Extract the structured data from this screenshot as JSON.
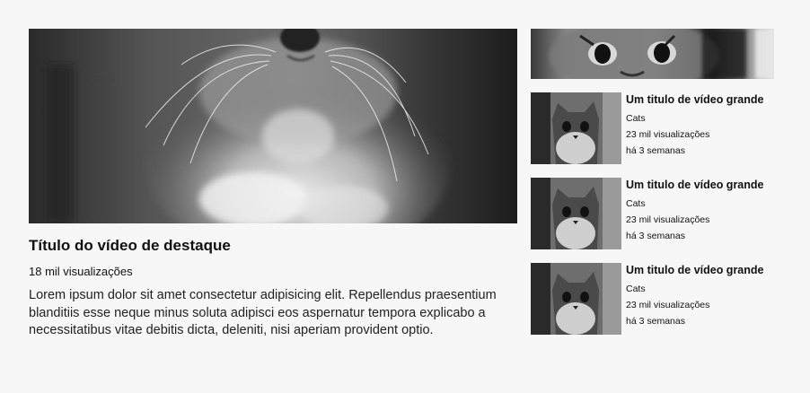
{
  "featured": {
    "thumbnail": "kitten-closeup-image",
    "title": "Título do vídeo de destaque",
    "views": "18 mil visualizações",
    "description": "Lorem ipsum dolor sit amet consectetur adipisicing elit. Repellendus praesentium blanditiis esse neque minus soluta adipisci eos aspernatur tempora explicabo a necessitatibus vitae debitis dicta, deleniti, nisi aperiam provident optio."
  },
  "sidebar": {
    "top_thumbnail": "kitten-eyes-banner-image",
    "videos": [
      {
        "thumbnail": "kitten-thumbnail-image",
        "title": "Um titulo de vídeo grande",
        "channel": "Cats",
        "views": "23 mil visualizações",
        "age": "há 3 semanas"
      },
      {
        "thumbnail": "kitten-thumbnail-image",
        "title": "Um titulo de vídeo grande",
        "channel": "Cats",
        "views": "23 mil visualizações",
        "age": "há 3 semanas"
      },
      {
        "thumbnail": "kitten-thumbnail-image",
        "title": "Um titulo de vídeo grande",
        "channel": "Cats",
        "views": "23 mil visualizações",
        "age": "há 3 semanas"
      }
    ]
  }
}
